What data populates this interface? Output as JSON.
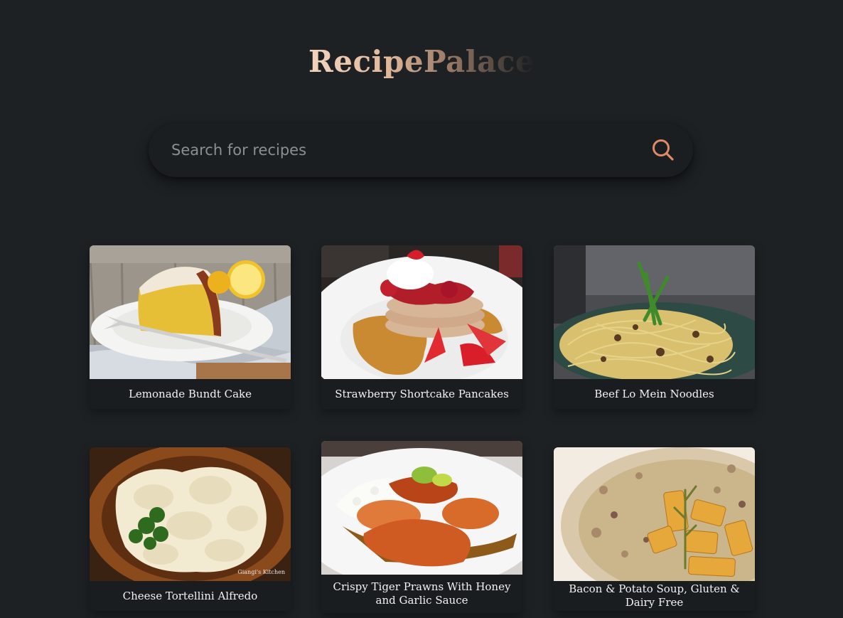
{
  "header": {
    "logo": "RecipePalace"
  },
  "search": {
    "placeholder": "Search for recipes",
    "icon": "search-icon"
  },
  "colors": {
    "background": "#1d2124",
    "accent": "#e08a66",
    "card": "#1a1d20"
  },
  "recipes": [
    {
      "title": "Lemonade Bundt Cake"
    },
    {
      "title": "Strawberry Shortcake Pancakes"
    },
    {
      "title": "Beef Lo Mein Noodles"
    },
    {
      "title": "Cheese Tortellini Alfredo",
      "watermark": "Giangi's Kitchen"
    },
    {
      "title": "Crispy Tiger Prawns With Honey and Garlic Sauce"
    },
    {
      "title": "Bacon & Potato Soup, Gluten & Dairy Free"
    }
  ]
}
